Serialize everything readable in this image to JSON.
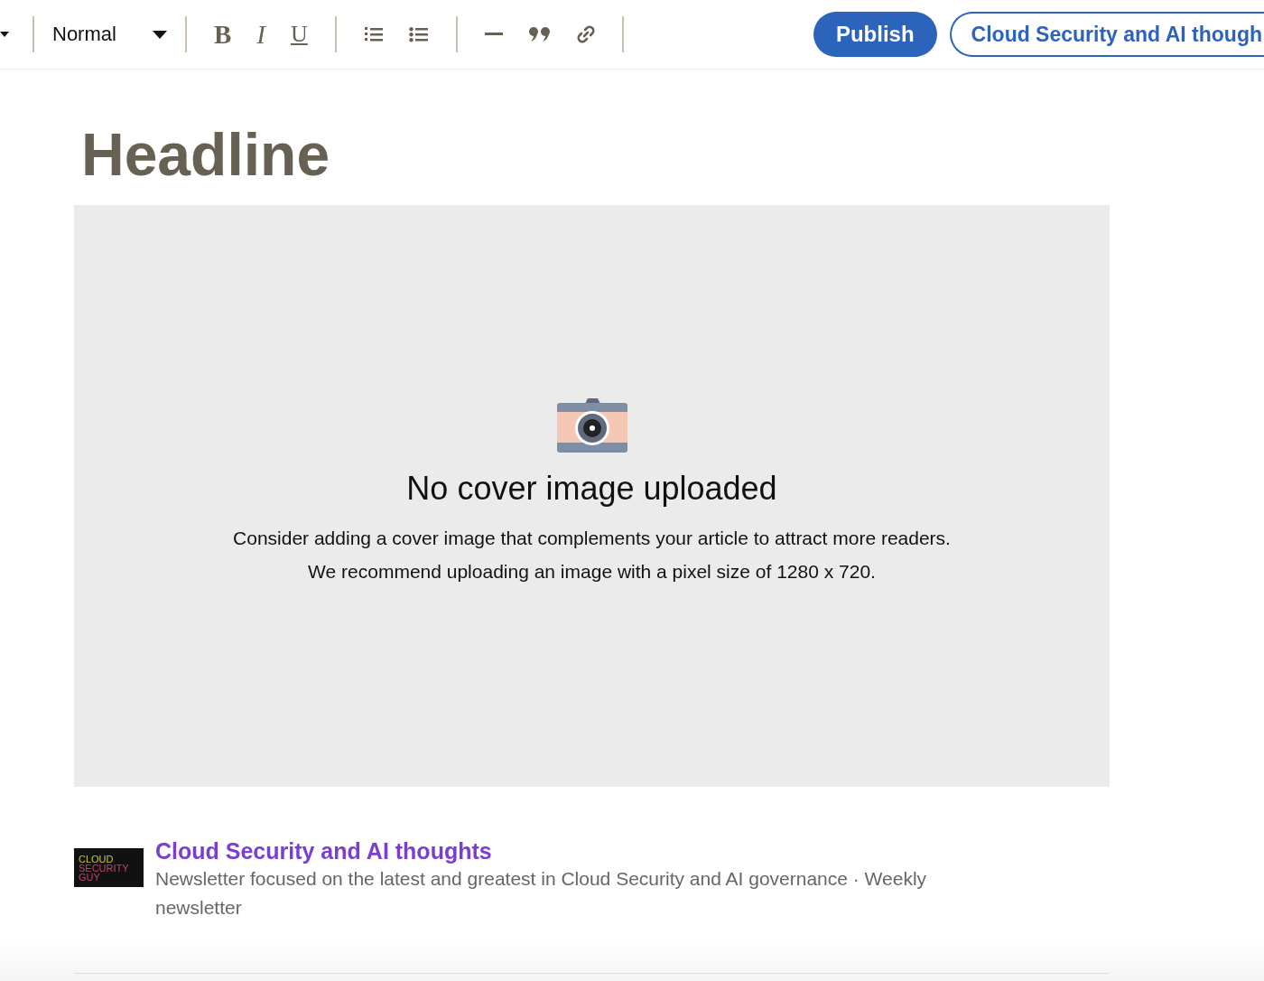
{
  "toolbar": {
    "style_select": {
      "value": "Normal"
    },
    "groups": [
      [
        {
          "kind": "bold",
          "label": "B"
        },
        {
          "kind": "italic",
          "label": "I"
        },
        {
          "kind": "underline",
          "label": "U"
        }
      ],
      [
        {
          "kind": "numbered-list"
        },
        {
          "kind": "bulleted-list"
        }
      ],
      [
        {
          "kind": "divider"
        },
        {
          "kind": "quote"
        },
        {
          "kind": "link"
        }
      ]
    ],
    "publish_button": "Publish",
    "newsletter_button": "Cloud Security and AI though"
  },
  "headline": {
    "placeholder": "Headline"
  },
  "cover": {
    "title": "No cover image uploaded",
    "lines": [
      "Consider adding a cover image that complements your article to attract more readers.",
      "We recommend uploading an image with a pixel size of 1280 x 720."
    ]
  },
  "newsletter": {
    "logo_lines": [
      {
        "text": "CLOUD",
        "color": "#c8c83c"
      },
      {
        "text": "SECURITY",
        "color": "#c0446a"
      },
      {
        "text": "GUY",
        "color": "#c0446a"
      }
    ],
    "title": "Cloud Security and AI thoughts",
    "description": "Newsletter focused on the latest and greatest in Cloud Security and AI governance · Weekly newsletter"
  }
}
